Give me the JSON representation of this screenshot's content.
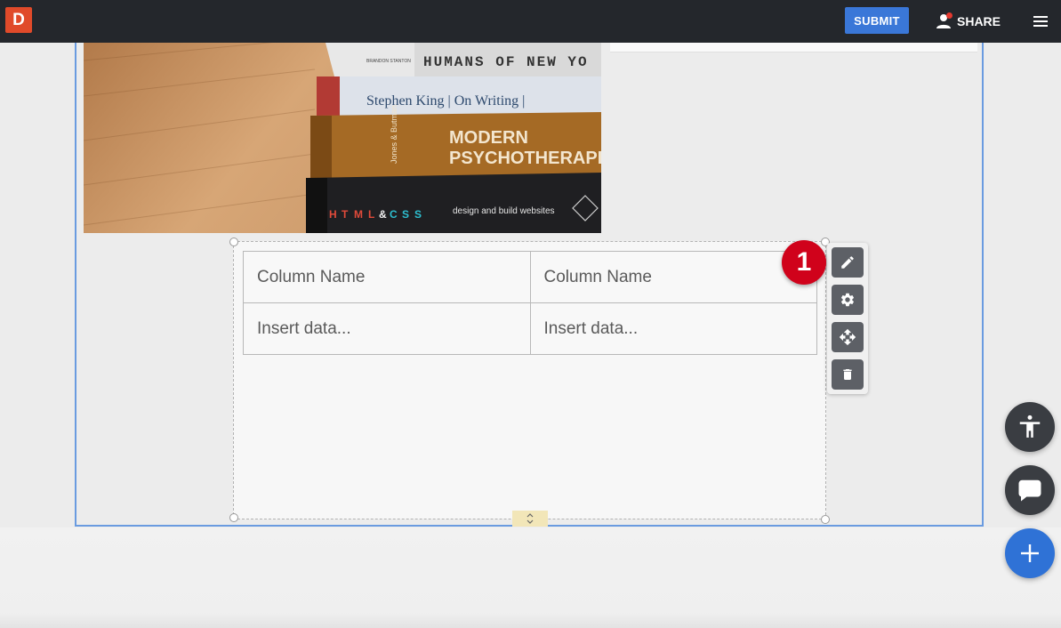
{
  "app": {
    "logo_letter": "D",
    "brand_color": "#e04a2a"
  },
  "topbar": {
    "submit_label": "SUBMIT",
    "share_label": "SHARE",
    "accent_color": "#3a77d8"
  },
  "image": {
    "book_titles": [
      "HUMANS OF NEW YO",
      "Stephen King | On Writing |",
      "MODERN",
      "PSYCHOTHERAPI",
      "design and build websites"
    ],
    "spine_author": "Jones & Butman",
    "spine_top": "BRANDON STANTON",
    "html_css_letters": [
      "H",
      "T",
      "M",
      "L",
      "&",
      "C",
      "S",
      "S"
    ]
  },
  "table": {
    "headers": [
      "Column Name",
      "Column Name"
    ],
    "rows": [
      [
        "Insert data...",
        "Insert data..."
      ]
    ]
  },
  "toolbar": {
    "step_number": "1",
    "buttons": [
      "edit-icon",
      "gear-icon",
      "move-icon",
      "trash-icon"
    ]
  },
  "fabs": [
    "accessibility-icon",
    "chat-icon",
    "plus-icon"
  ]
}
